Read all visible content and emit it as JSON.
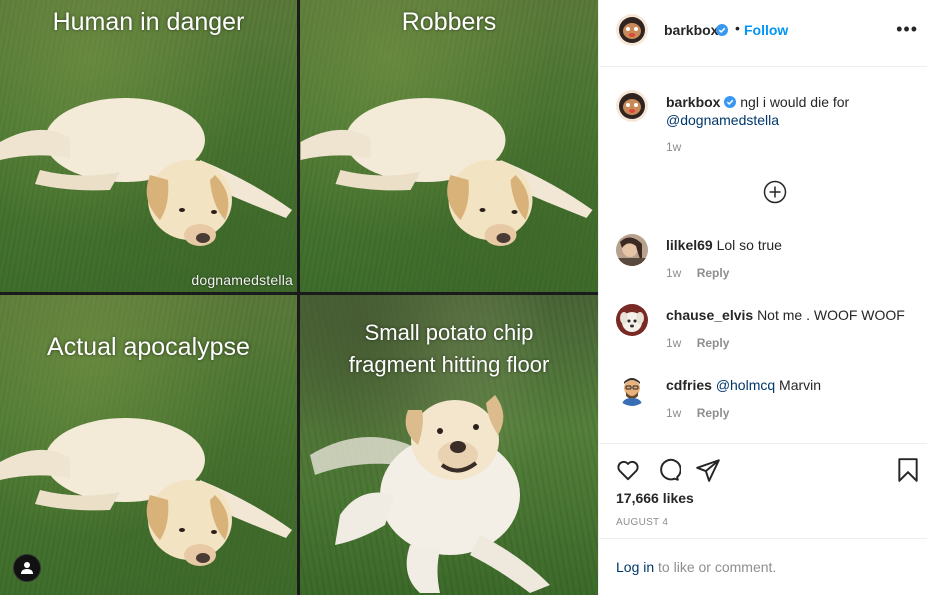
{
  "post": {
    "panels": [
      {
        "caption": "Human in danger",
        "watermark": "dognamedstella"
      },
      {
        "caption": "Robbers"
      },
      {
        "caption": "Actual apocalypse"
      },
      {
        "caption_line1": "Small potato chip",
        "caption_line2": "fragment hitting floor"
      }
    ],
    "user_tag_icon": "person-icon"
  },
  "header": {
    "username": "barkbox",
    "separator": "•",
    "follow_label": "Follow",
    "more_label": "•••"
  },
  "caption": {
    "username": "barkbox",
    "text": "ngl i would die for",
    "mention": "@dognamedstella",
    "time": "1w",
    "load_more_icon": "plus-circle-icon"
  },
  "comments": [
    {
      "username": "lilkel69",
      "text": "Lol so true",
      "time": "1w",
      "reply": "Reply"
    },
    {
      "username": "chause_elvis",
      "text": "Not me . WOOF WOOF",
      "time": "1w",
      "reply": "Reply"
    },
    {
      "username": "cdfries",
      "mention": "@holmcq",
      "text": "Marvin",
      "time": "1w",
      "reply": "Reply"
    }
  ],
  "actions": {
    "icons": [
      "heart-icon",
      "comment-icon",
      "share-icon",
      "bookmark-icon"
    ],
    "likes": "17,666 likes",
    "date": "AUGUST 4"
  },
  "login": {
    "link": "Log in",
    "text": " to like or comment."
  },
  "colors": {
    "link_blue": "#0095f6",
    "mention_blue": "#00376b",
    "muted": "#8e8e8e",
    "verified": "#3897f0"
  }
}
